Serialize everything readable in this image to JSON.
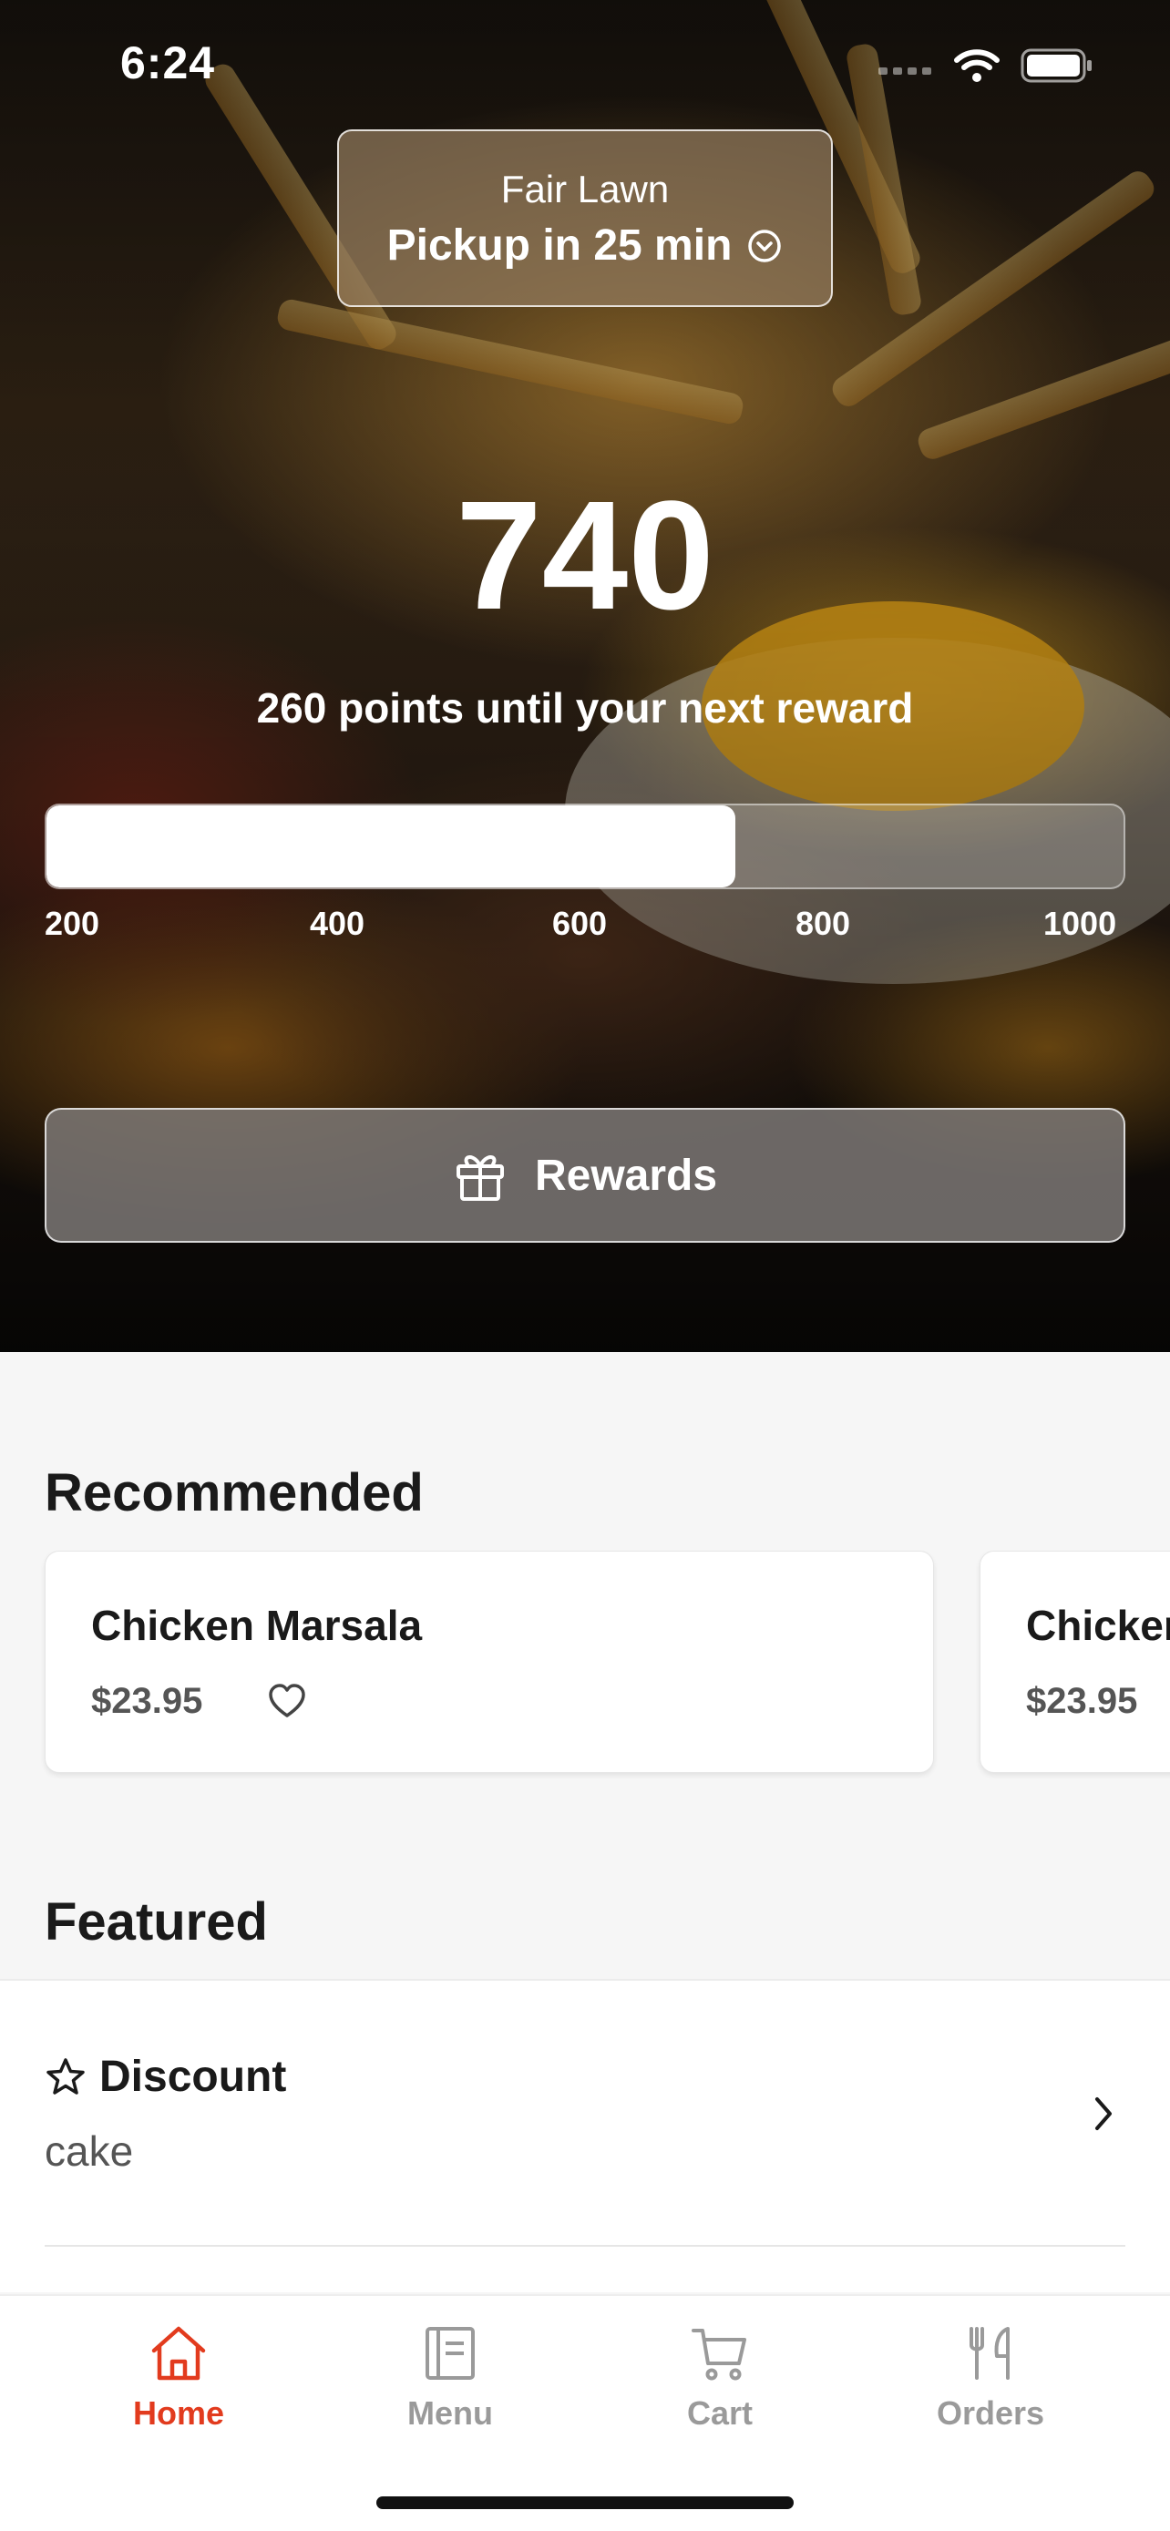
{
  "status_bar": {
    "time": "6:24"
  },
  "location": {
    "name": "Fair Lawn",
    "pickup": "Pickup in 25 min"
  },
  "loyalty": {
    "points": "740",
    "subtitle": "260 points until your next reward",
    "progress_fraction": 0.64,
    "tick_labels": [
      "200",
      "400",
      "600",
      "800",
      "1000"
    ]
  },
  "rewards_button": {
    "label": "Rewards"
  },
  "recommended": {
    "title": "Recommended",
    "items": [
      {
        "name": "Chicken Marsala",
        "price": "$23.95"
      },
      {
        "name": "Chicken Marsala",
        "price": "$23.95"
      }
    ]
  },
  "featured": {
    "title": "Featured",
    "items": [
      {
        "title": "Discount",
        "subtitle": "cake"
      }
    ]
  },
  "tabbar": {
    "tabs": [
      {
        "label": "Home",
        "icon": "home-icon",
        "active": true
      },
      {
        "label": "Menu",
        "icon": "menu-icon",
        "active": false
      },
      {
        "label": "Cart",
        "icon": "cart-icon",
        "active": false
      },
      {
        "label": "Orders",
        "icon": "orders-icon",
        "active": false
      }
    ]
  },
  "colors": {
    "accent": "#e23b1e",
    "tab_inactive": "#9a9a9a"
  }
}
